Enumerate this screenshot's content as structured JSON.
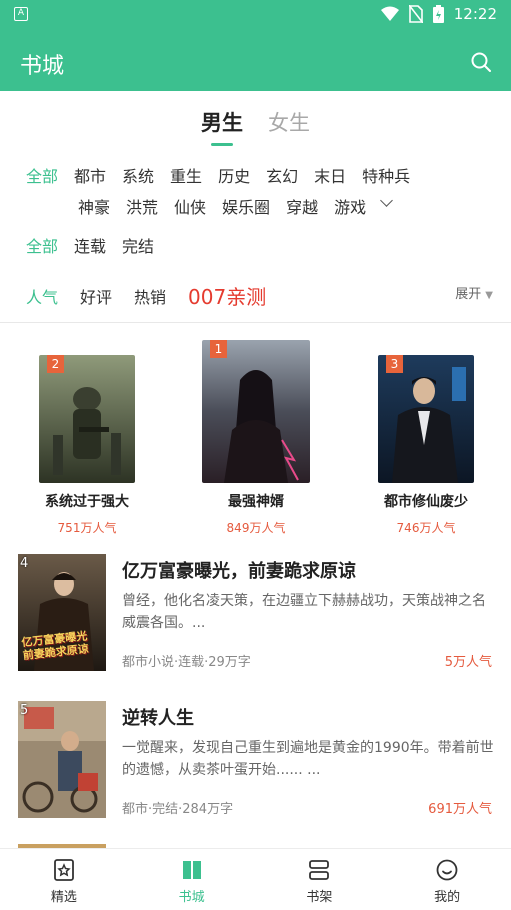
{
  "status_bar": {
    "time": "12:22"
  },
  "header": {
    "title": "书城"
  },
  "gender_tabs": [
    "男生",
    "女生"
  ],
  "categories_row1": [
    "全部",
    "都市",
    "系统",
    "重生",
    "历史",
    "玄幻",
    "末日",
    "特种兵"
  ],
  "categories_row2": [
    "神豪",
    "洪荒",
    "仙侠",
    "娱乐圈",
    "穿越",
    "游戏"
  ],
  "status_filters": [
    "全部",
    "连载",
    "完结"
  ],
  "sort_filters": [
    "人气",
    "好评",
    "热销"
  ],
  "promo_text": "007亲测",
  "expand_label": "展开",
  "top_books": [
    {
      "rank": "2",
      "title": "系统过于强大",
      "popularity": "751万人气"
    },
    {
      "rank": "1",
      "title": "最强神婿",
      "popularity": "849万人气"
    },
    {
      "rank": "3",
      "title": "都市修仙废少",
      "popularity": "746万人气"
    }
  ],
  "list_books": [
    {
      "rank": "4",
      "title": "亿万富豪曝光，前妻跪求原谅",
      "description": "曾经，他化名凌天策，在边疆立下赫赫战功，天策战神之名威震各国。...",
      "meta": "都市小说·连载·29万字",
      "popularity": "5万人气",
      "cover_text": "亿万富豪曝光 前妻跪求原谅"
    },
    {
      "rank": "5",
      "title": "逆转人生",
      "description": "一觉醒来，发现自己重生到遍地是黄金的1990年。带着前世的遗憾，从卖茶叶蛋开始...... ...",
      "meta": "都市·完结·284万字",
      "popularity": "691万人气"
    }
  ],
  "bottom_nav": [
    "精选",
    "书城",
    "书架",
    "我的"
  ],
  "colors": {
    "accent": "#3cc08f",
    "popularity": "#e55a3e",
    "promo": "#e53b2f"
  }
}
